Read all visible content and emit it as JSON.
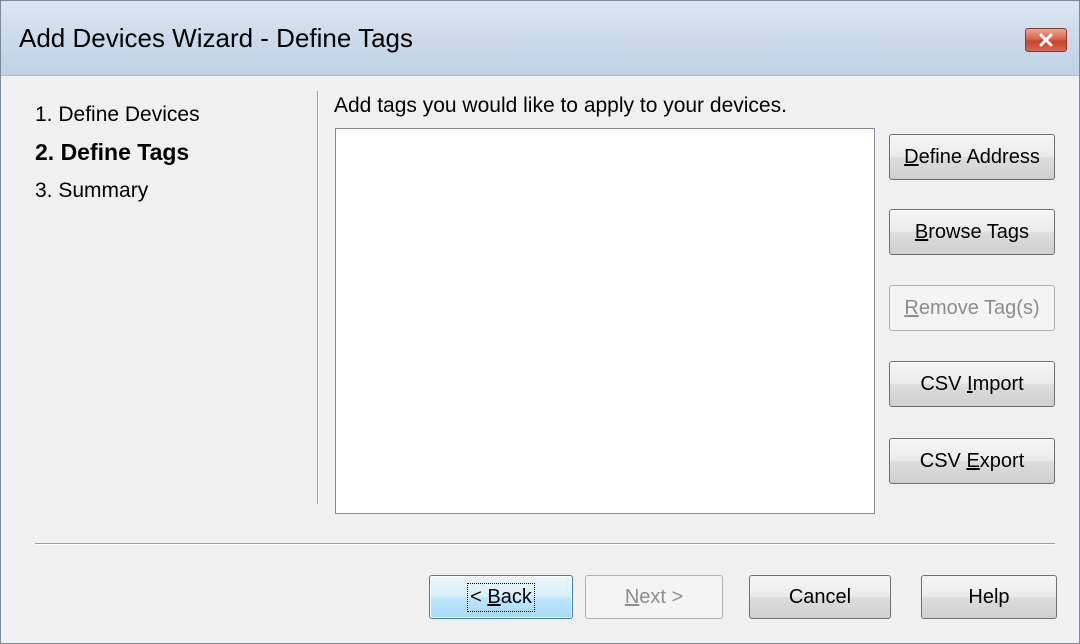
{
  "window": {
    "title": "Add Devices Wizard - Define Tags"
  },
  "steps": [
    {
      "label": "1. Define Devices",
      "active": false
    },
    {
      "label": "2. Define Tags",
      "active": true
    },
    {
      "label": "3. Summary",
      "active": false
    }
  ],
  "main": {
    "instruction": "Add tags you would like to apply to your devices.",
    "tag_items": []
  },
  "side_buttons": {
    "define_address": {
      "pre": "",
      "mnemonic": "D",
      "post": "efine Address",
      "enabled": true
    },
    "browse_tags": {
      "pre": "",
      "mnemonic": "B",
      "post": "rowse Tags",
      "enabled": true
    },
    "remove_tags": {
      "pre": "",
      "mnemonic": "R",
      "post": "emove Tag(s)",
      "enabled": false
    },
    "csv_import": {
      "pre": "CSV ",
      "mnemonic": "I",
      "post": "mport",
      "enabled": true
    },
    "csv_export": {
      "pre": "CSV ",
      "mnemonic": "E",
      "post": "xport",
      "enabled": true
    }
  },
  "footer": {
    "back": {
      "pre": "< ",
      "mnemonic": "B",
      "post": "ack",
      "enabled": true
    },
    "next": {
      "pre": "",
      "mnemonic": "N",
      "post": "ext >",
      "enabled": false
    },
    "cancel": {
      "label": "Cancel"
    },
    "help": {
      "label": "Help"
    }
  },
  "colors": {
    "title_bar": "#cddbeb",
    "close_button": "#c7432a",
    "window_background": "#f0f0f0"
  }
}
